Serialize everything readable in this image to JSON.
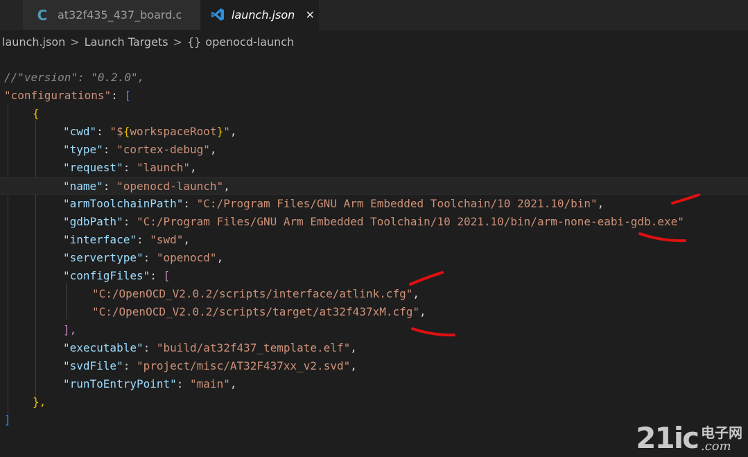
{
  "tabs": [
    {
      "label": "at32f435_437_board.c",
      "icon": "c-icon",
      "active": false
    },
    {
      "label": "launch.json",
      "icon": "vscode-icon",
      "active": true,
      "close": "✕"
    }
  ],
  "breadcrumb": {
    "file": "launch.json",
    "section": "Launch Targets",
    "braces": "{}",
    "item": "openocd-launch",
    "separator": ">"
  },
  "code": {
    "version_comment": "//\"version\": \"0.2.0\",",
    "configurations_key": "\"configurations\"",
    "open_bracket": "[",
    "open_brace": "{",
    "cwd_key": "\"cwd\"",
    "cwd_value_open": "\"$",
    "cwd_value_brace_open": "{",
    "cwd_value_name": "workspaceRoot",
    "cwd_value_brace_close": "}",
    "cwd_value_close": "\"",
    "type_key": "\"type\"",
    "type_value": "\"cortex-debug\"",
    "request_key": "\"request\"",
    "request_value": "\"launch\"",
    "name_key": "\"name\"",
    "name_value": "\"openocd-launch\"",
    "arm_key": "\"armToolchainPath\"",
    "arm_value": "\"C:/Program Files/GNU Arm Embedded Toolchain/10 2021.10/bin\"",
    "gdb_key": "\"gdbPath\"",
    "gdb_value": "\"C:/Program Files/GNU Arm Embedded Toolchain/10 2021.10/bin/arm-none-eabi-gdb.exe\"",
    "interface_key": "\"interface\"",
    "interface_value": "\"swd\"",
    "servertype_key": "\"servertype\"",
    "servertype_value": "\"openocd\"",
    "configfiles_key": "\"configFiles\"",
    "configfile_1": "\"C:/OpenOCD_V2.0.2/scripts/interface/atlink.cfg\"",
    "configfile_2": "\"C:/OpenOCD_V2.0.2/scripts/target/at32f437xM.cfg\"",
    "close_bracket_comma": "],",
    "executable_key": "\"executable\"",
    "executable_value": "\"build/at32f437_template.elf\"",
    "svd_key": "\"svdFile\"",
    "svd_value": "\"project/misc/AT32F437xx_v2.svd\"",
    "run_key": "\"runToEntryPoint\"",
    "run_value": "\"main\"",
    "close_brace_comma": "},",
    "close_bracket": "]",
    "colon": ": ",
    "comma": ","
  },
  "watermark": {
    "number": "21ic",
    "chinese": "电子网",
    "domain": ".com"
  },
  "colors": {
    "background": "#1e1e1e",
    "key": "#9cdcfe",
    "string": "#ce9178",
    "annotation": "#e01010"
  }
}
